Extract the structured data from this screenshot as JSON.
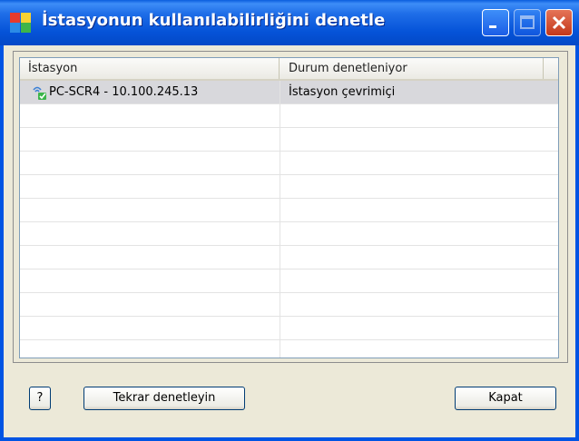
{
  "window": {
    "title": "İstasyonun kullanılabilirliğini denetle",
    "icon": "avg-app-icon"
  },
  "titlebar_buttons": [
    "minimize-icon",
    "maximize-icon",
    "close-icon"
  ],
  "list": {
    "columns": [
      "İstasyon",
      "Durum denetleniyor"
    ],
    "rows": [
      {
        "station": "PC-SCR4 - 10.100.245.13",
        "status": "İstasyon çevrimiçi",
        "icon": "network-station-icon",
        "selected": true
      }
    ]
  },
  "buttons": {
    "help_label": "?",
    "retry_label": "Tekrar denetleyin",
    "close_label": "Kapat"
  },
  "colors": {
    "titlebar": "#0054e3",
    "dialog_bg": "#ece9d8",
    "selected_row": "#d8d8dc"
  }
}
